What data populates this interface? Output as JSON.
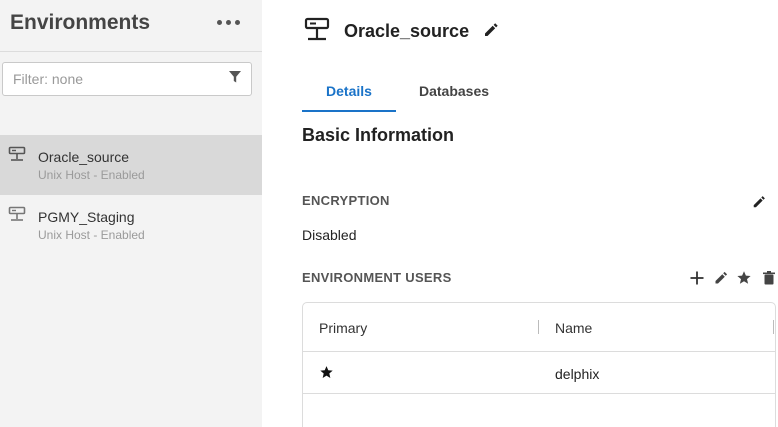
{
  "sidebar": {
    "title": "Environments",
    "more_icon": "more-horizontal-icon",
    "filter": {
      "placeholder": "Filter: none",
      "value": "",
      "icon": "filter-icon"
    },
    "items": [
      {
        "name": "Oracle_source",
        "subtitle": "Unix Host - Enabled",
        "icon": "host-icon",
        "selected": true
      },
      {
        "name": "PGMY_Staging",
        "subtitle": "Unix Host - Enabled",
        "icon": "host-icon",
        "selected": false
      }
    ]
  },
  "main": {
    "title": "Oracle_source",
    "title_icon": "host-icon",
    "edit_icon": "pencil-icon",
    "tabs": [
      {
        "label": "Details",
        "active": true
      },
      {
        "label": "Databases",
        "active": false
      }
    ],
    "section_title": "Basic Information",
    "encryption": {
      "label": "ENCRYPTION",
      "value": "Disabled"
    },
    "users": {
      "label": "ENVIRONMENT USERS",
      "actions": [
        "plus-icon",
        "pencil-icon",
        "star-icon",
        "trash-icon"
      ],
      "columns": [
        "Primary",
        "Name"
      ],
      "rows": [
        {
          "primary": true,
          "name": "delphix"
        }
      ]
    }
  },
  "colors": {
    "accent": "#1a73c8",
    "sidebar_bg": "#f3f3f3",
    "selected_bg": "#d9d9d9"
  }
}
